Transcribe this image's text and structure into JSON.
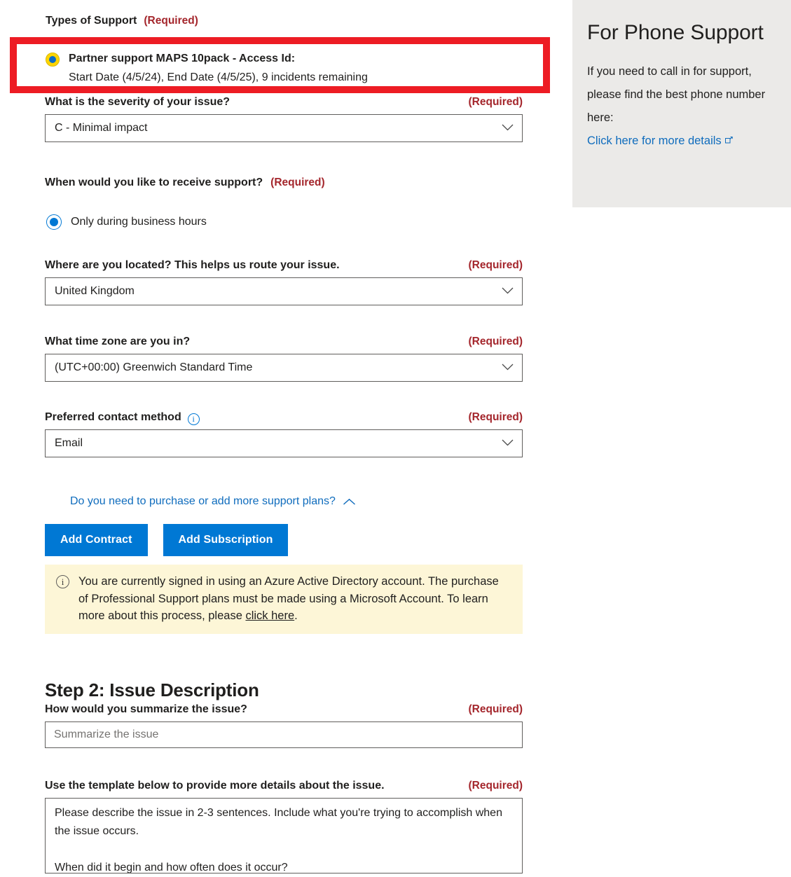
{
  "form": {
    "types_of_support": {
      "label": "Types of Support",
      "required": "(Required)",
      "plan_title": "Partner support MAPS 10pack - Access Id:",
      "plan_details": "Start Date (4/5/24), End Date (4/5/25), 9 incidents remaining",
      "highlight_color": "#ed1c24",
      "radio_ring_color": "#ffd500",
      "radio_dot_color": "#0d6dc6"
    },
    "severity": {
      "label": "What is the severity of your issue?",
      "required": "(Required)",
      "value": "C - Minimal impact"
    },
    "when_support": {
      "label": "When would you like to receive support?",
      "required": "(Required)",
      "option": "Only during business hours"
    },
    "location": {
      "label": "Where are you located? This helps us route your issue.",
      "required": "(Required)",
      "value": "United Kingdom"
    },
    "timezone": {
      "label": "What time zone are you in?",
      "required": "(Required)",
      "value": "(UTC+00:00) Greenwich Standard Time"
    },
    "contact_method": {
      "label": "Preferred contact method",
      "info_icon": "info-icon",
      "required": "(Required)",
      "value": "Email"
    },
    "purchase_link": {
      "text": "Do you need to purchase or add more support plans?",
      "caret_icon": "chevron-up-icon"
    },
    "buttons": {
      "add_contract": "Add Contract",
      "add_subscription": "Add Subscription"
    },
    "banner": {
      "icon": "info-icon",
      "text_before": "You are currently signed in using an Azure Active Directory account. The purchase of Professional Support plans must be made using a Microsoft Account. To learn more about this process, please ",
      "link": "click here",
      "text_after": ".",
      "background_color": "#fdf6d7"
    }
  },
  "step2": {
    "title": "Step 2: Issue Description",
    "summary": {
      "label": "How would you summarize the issue?",
      "required": "(Required)",
      "placeholder": "Summarize the issue",
      "value": ""
    },
    "details": {
      "label": "Use the template below to provide more details about the issue.",
      "required": "(Required)",
      "value": "Please describe the issue in 2-3 sentences. Include what you're trying to accomplish when the issue occurs.\n\nWhen did it begin and how often does it occur?"
    }
  },
  "phone_support": {
    "title": "For Phone Support",
    "body": "If you need to call in for support, please find the best phone number here:",
    "link": "Click here for more details",
    "link_icon": "external-link-icon",
    "link_color": "#0f6cbd",
    "panel_color": "#ebeae8"
  },
  "theme": {
    "accent": "#0078d4",
    "required_red": "#a4262c",
    "link_blue": "#0f6cbd"
  }
}
